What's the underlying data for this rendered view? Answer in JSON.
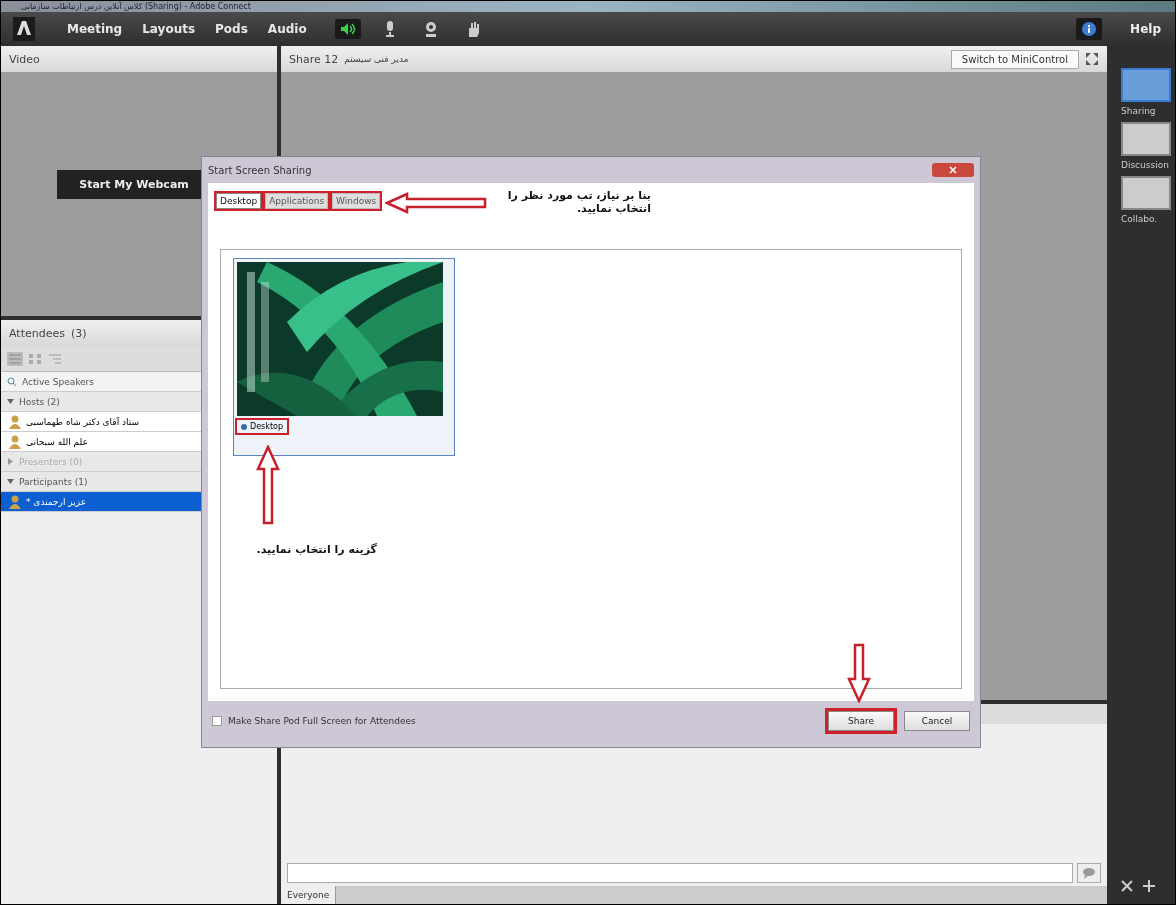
{
  "window": {
    "title": "کلاس آنلاین درس ارتباطات سازمانی (Sharing) - Adobe Connect"
  },
  "menu": [
    {
      "label": "Meeting"
    },
    {
      "label": "Layouts"
    },
    {
      "label": "Pods"
    },
    {
      "label": "Audio"
    }
  ],
  "audio_controls": {
    "speaker_on": true
  },
  "help": {
    "label": "Help"
  },
  "video_pod": {
    "title": "Video",
    "button": "Start My Webcam"
  },
  "attendees_pod": {
    "title": "Attendees",
    "count": "(3)",
    "active_speakers": "Active Speakers",
    "groups": [
      {
        "label": "Hosts (2)",
        "expanded": true,
        "disabled": false,
        "children": [
          {
            "name": "ستاد آقای دکتر شاه طهماسبی",
            "selected": false
          },
          {
            "name": "علم الله سبحانی",
            "selected": false
          }
        ]
      },
      {
        "label": "Presenters (0)",
        "expanded": false,
        "disabled": true
      },
      {
        "label": "Participants (1)",
        "expanded": true,
        "disabled": false,
        "children": [
          {
            "name": "عزیز ارجمندی *",
            "selected": true
          }
        ]
      }
    ]
  },
  "share_pod": {
    "title": "Share 12",
    "subtitle": "مدیر فنی سیستم",
    "button": "Switch to MiniControl"
  },
  "layouts": [
    {
      "label": "Sharing",
      "selected": true
    },
    {
      "label": "Discussion",
      "selected": false
    },
    {
      "label": "Collabo.",
      "selected": false
    }
  ],
  "dialog": {
    "title": "Start Screen Sharing",
    "tabs": [
      {
        "label": "Desktop",
        "selected": true,
        "highlighted": true
      },
      {
        "label": "Applications",
        "selected": false,
        "highlighted": true
      },
      {
        "label": "Windows",
        "selected": false,
        "highlighted": true
      }
    ],
    "items": [
      {
        "label": "Desktop",
        "selected": true,
        "highlighted": true
      }
    ],
    "fullscreen_option": {
      "label": "Make Share Pod Full Screen for Attendees",
      "checked": false
    },
    "buttons": [
      {
        "label": "Share",
        "highlighted": true
      },
      {
        "label": "Cancel",
        "highlighted": false
      }
    ]
  },
  "annotations": [
    {
      "text": "بنا بر نیاز، تب مورد نظر را انتخاب نمایید."
    },
    {
      "text": "گزینه را انتخاب نمایید."
    }
  ],
  "chat_pod": {
    "tabs": [
      {
        "label": "Everyone",
        "selected": true
      }
    ]
  }
}
